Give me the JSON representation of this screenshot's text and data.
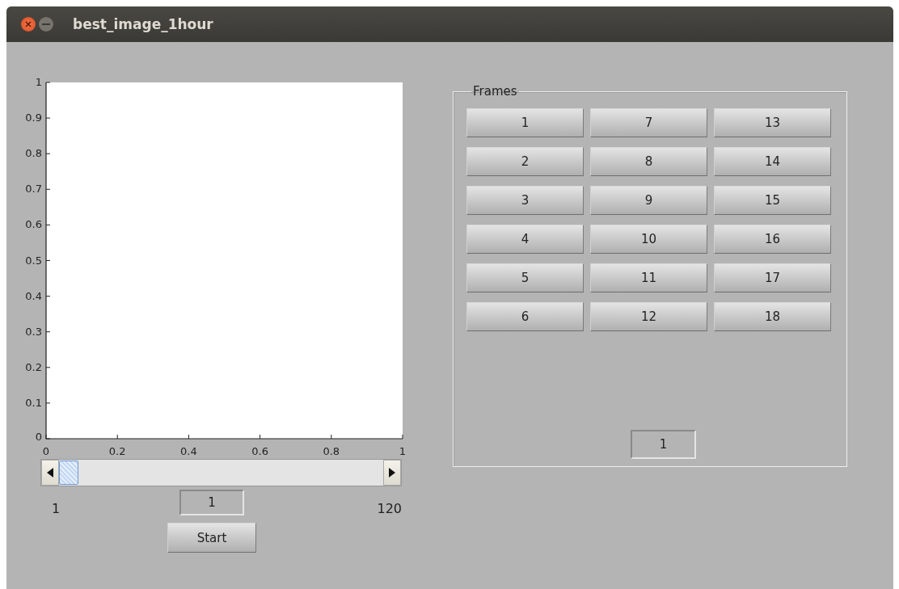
{
  "window": {
    "title": "best_image_1hour"
  },
  "plot": {
    "xticks": [
      "0",
      "0.2",
      "0.4",
      "0.6",
      "0.8",
      "1"
    ],
    "yticks": [
      "1",
      "0.9",
      "0.8",
      "0.7",
      "0.6",
      "0.5",
      "0.4",
      "0.3",
      "0.2",
      "0.1",
      "0"
    ]
  },
  "slider": {
    "level": 0,
    "min_label": "1",
    "max_label": "120",
    "value": "1"
  },
  "start_button": "Start",
  "frames": {
    "title": "Frames",
    "buttons": [
      "1",
      "2",
      "3",
      "4",
      "5",
      "6",
      "7",
      "8",
      "9",
      "10",
      "11",
      "12",
      "13",
      "14",
      "15",
      "16",
      "17",
      "18"
    ],
    "value": "1"
  }
}
